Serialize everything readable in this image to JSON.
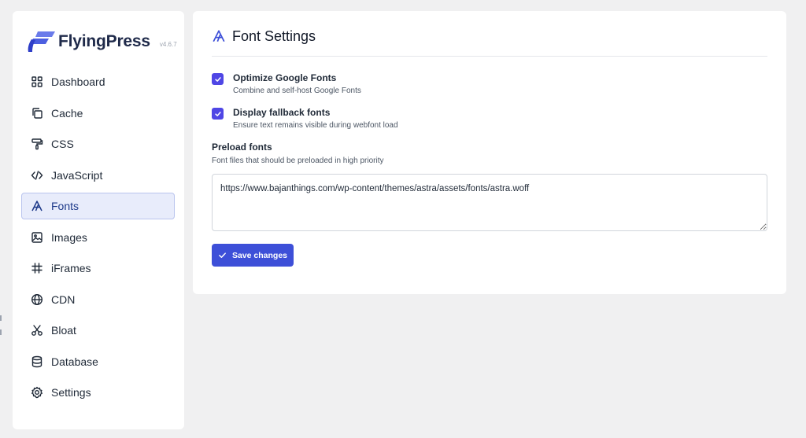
{
  "brand": {
    "name": "FlyingPress",
    "version": "v4.6.7",
    "accent": "#3b4fd8"
  },
  "sidebar": {
    "items": [
      {
        "label": "Dashboard",
        "icon": "grid-icon"
      },
      {
        "label": "Cache",
        "icon": "copy-icon"
      },
      {
        "label": "CSS",
        "icon": "paint-roller-icon"
      },
      {
        "label": "JavaScript",
        "icon": "code-icon"
      },
      {
        "label": "Fonts",
        "icon": "font-icon",
        "active": true
      },
      {
        "label": "Images",
        "icon": "image-icon"
      },
      {
        "label": "iFrames",
        "icon": "hash-icon"
      },
      {
        "label": "CDN",
        "icon": "globe-icon"
      },
      {
        "label": "Bloat",
        "icon": "scissors-icon"
      },
      {
        "label": "Database",
        "icon": "database-icon"
      },
      {
        "label": "Settings",
        "icon": "gear-icon"
      }
    ]
  },
  "panel": {
    "title": "Font Settings",
    "title_icon": "font-icon",
    "options": [
      {
        "label": "Optimize Google Fonts",
        "description": "Combine and self-host Google Fonts",
        "checked": true
      },
      {
        "label": "Display fallback fonts",
        "description": "Ensure text remains visible during webfont load",
        "checked": true
      }
    ],
    "preload": {
      "label": "Preload fonts",
      "description": "Font files that should be preloaded in high priority",
      "value": "https://www.bajanthings.com/wp-content/themes/astra/assets/fonts/astra.woff"
    },
    "save_label": "Save changes"
  },
  "colors": {
    "primary": "#3d4fd8",
    "checkbox": "#4f46e5",
    "active_bg": "#e8ecfb"
  }
}
